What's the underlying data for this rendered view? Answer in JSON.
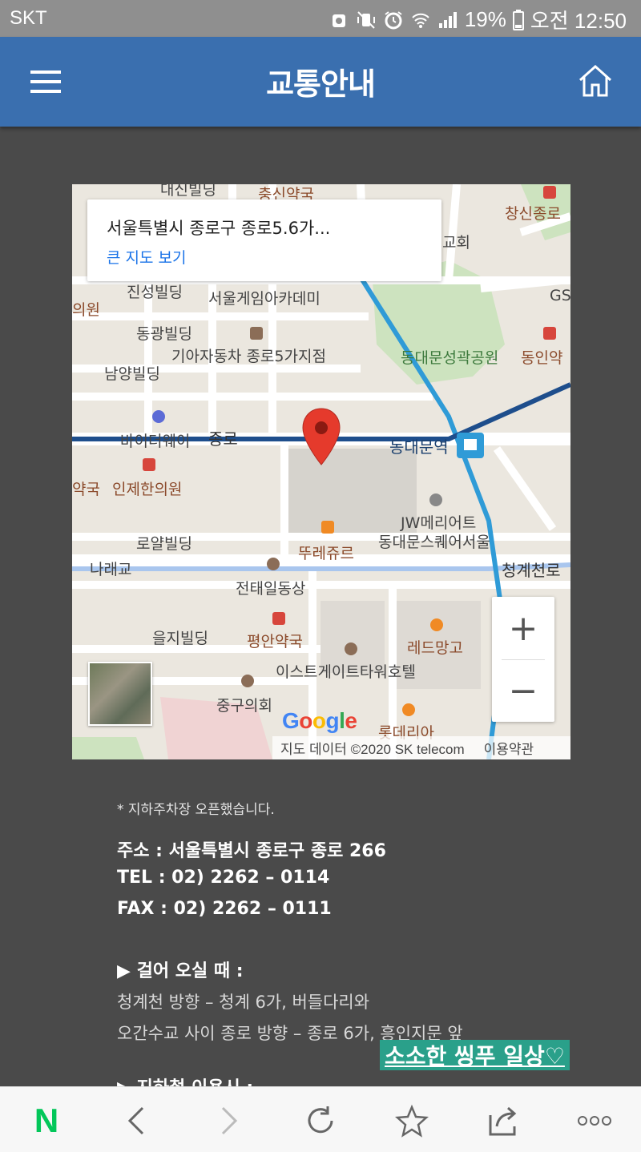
{
  "status_bar": {
    "carrier": "SKT",
    "battery": "19%",
    "time": "오전 12:50"
  },
  "header": {
    "title": "교통안내",
    "bg_color": "#3a6faf"
  },
  "map": {
    "info_window": {
      "address": "서울특별시 종로구 종로5.6가...",
      "link": "큰 지도 보기"
    },
    "labels": {
      "daeshin": "대신빌딩",
      "chungsin_pharmacy": "충신약국",
      "changsin": "창신종로",
      "gyohoe": "교회",
      "jinseong": "진성빌딩",
      "game_academy": "서울게임아카데미",
      "clinic_left": "의원",
      "gs": "GS",
      "donggwang": "동광빌딩",
      "kia": "기아자동차 종로5가지점",
      "dongdaemun_park": "동대문성곽공원",
      "dongin_pharmacy": "동인약",
      "namyang": "남양빌딩",
      "buyer_way": "바이더웨이",
      "jongno": "종로",
      "dongdaemun_station": "동대문역",
      "pharmacy_left": "약국",
      "injehan": "인제한의원",
      "jw_marriott_1": "JW메리어트",
      "jw_marriott_2": "동대문스퀘어서울",
      "royal": "로얄빌딩",
      "ttureju": "뚜레쥬르",
      "naraegyo": "나래교",
      "cheonggyecheon": "청계천로",
      "jeontaeil": "전태일동상",
      "euljiro": "을지빌딩",
      "pyeongan": "평안약국",
      "red_mango": "레드망고",
      "eastgate": "이스트게이트타워호텔",
      "jung_council": "중구의회",
      "lotteria": "롯데리아"
    },
    "zoom_in": "+",
    "zoom_out": "−",
    "google": "Google",
    "attribution": "지도 데이터 ©2020 SK telecom",
    "terms": "이용약관",
    "pin_color": "#e53a2c",
    "route_color": "#1e4e8c"
  },
  "content": {
    "notice": "* 지하주차장 오픈했습니다.",
    "address": "주소 : 서울특별시 종로구 종로 266",
    "tel": "TEL : 02) 2262 – 0114",
    "fax": "FAX : 02) 2262 – 0111",
    "walk_heading": "▶ 걸어 오실 때 :",
    "walk_line1": "청계천 방향 – 청계 6가, 버들다리와",
    "walk_line2": "오간수교 사이 종로 방향 – 종로 6가, 흥인지문 앞",
    "subway_heading": "▶ 지하철 이용시 :",
    "watermark": "소소한 씽푸 일상♡"
  },
  "bottom_bar": {
    "naver_logo": "N",
    "naver_color": "#03c75a"
  }
}
